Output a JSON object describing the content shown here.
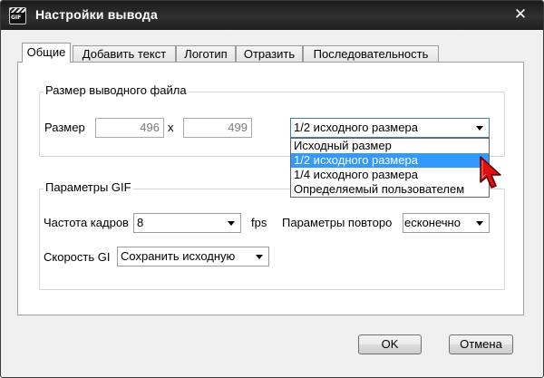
{
  "window": {
    "title": "Настройки вывода",
    "icon_text": "GIF",
    "close_glyph": "✕"
  },
  "tabs": [
    {
      "label": "Общие",
      "active": true
    },
    {
      "label": "Добавить текст",
      "active": false
    },
    {
      "label": "Логотип",
      "active": false
    },
    {
      "label": "Отразить",
      "active": false
    },
    {
      "label": "Последовательность",
      "active": false
    }
  ],
  "output_size": {
    "legend": "Размер выводного файла",
    "size_label": "Размер",
    "width_value": "496",
    "separator": "x",
    "height_value": "499",
    "preset_selected": "1/2 исходного размера",
    "preset_options": [
      "Исходный размер",
      "1/2 исходного размера",
      "1/4 исходного размера",
      "Определяемый пользователем"
    ],
    "highlighted_option_index": 1
  },
  "gif_params": {
    "legend": "Параметры GIF",
    "frame_rate_label": "Частота кадров",
    "frame_rate_value": "8",
    "fps_unit": "fps",
    "repeat_label": "Параметры повторо",
    "repeat_value": "есконечно",
    "speed_label": "Скорость GI",
    "speed_value": "Сохранить исходную"
  },
  "buttons": {
    "ok": "OK",
    "cancel": "Отмена"
  },
  "colors": {
    "titlebar": "#1e1e1e",
    "selection": "#3399ff",
    "cursor": "#e01010"
  },
  "icons": {
    "app": "gif-clapperboard-icon",
    "close": "close-icon",
    "combo_arrow": "chevron-down-icon",
    "pointer": "mouse-pointer-icon"
  }
}
